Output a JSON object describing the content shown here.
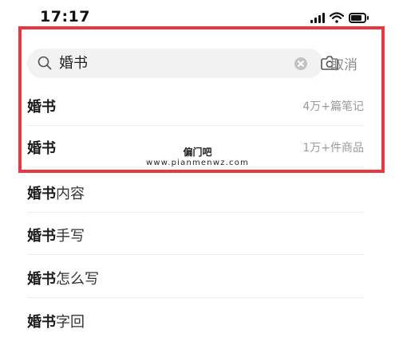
{
  "status_bar": {
    "time": "17:17"
  },
  "search": {
    "query": "婚书",
    "cancel_label": "取消"
  },
  "suggestions": [
    {
      "keyword": "婚书",
      "suffix": "",
      "meta": "4万+篇笔记"
    },
    {
      "keyword": "婚书",
      "suffix": "",
      "meta": "1万+件商品"
    },
    {
      "keyword": "婚书",
      "suffix": "内容",
      "meta": ""
    },
    {
      "keyword": "婚书",
      "suffix": "手写",
      "meta": ""
    },
    {
      "keyword": "婚书",
      "suffix": "怎么写",
      "meta": ""
    },
    {
      "keyword": "婚书",
      "suffix": "字回",
      "meta": ""
    }
  ],
  "watermark": {
    "title": "偏门吧",
    "url": "www.pianmenwz.com"
  },
  "colors": {
    "highlight": "#e8383d",
    "search_bg": "#f2f2f2",
    "muted_text": "#9a9a9a"
  }
}
